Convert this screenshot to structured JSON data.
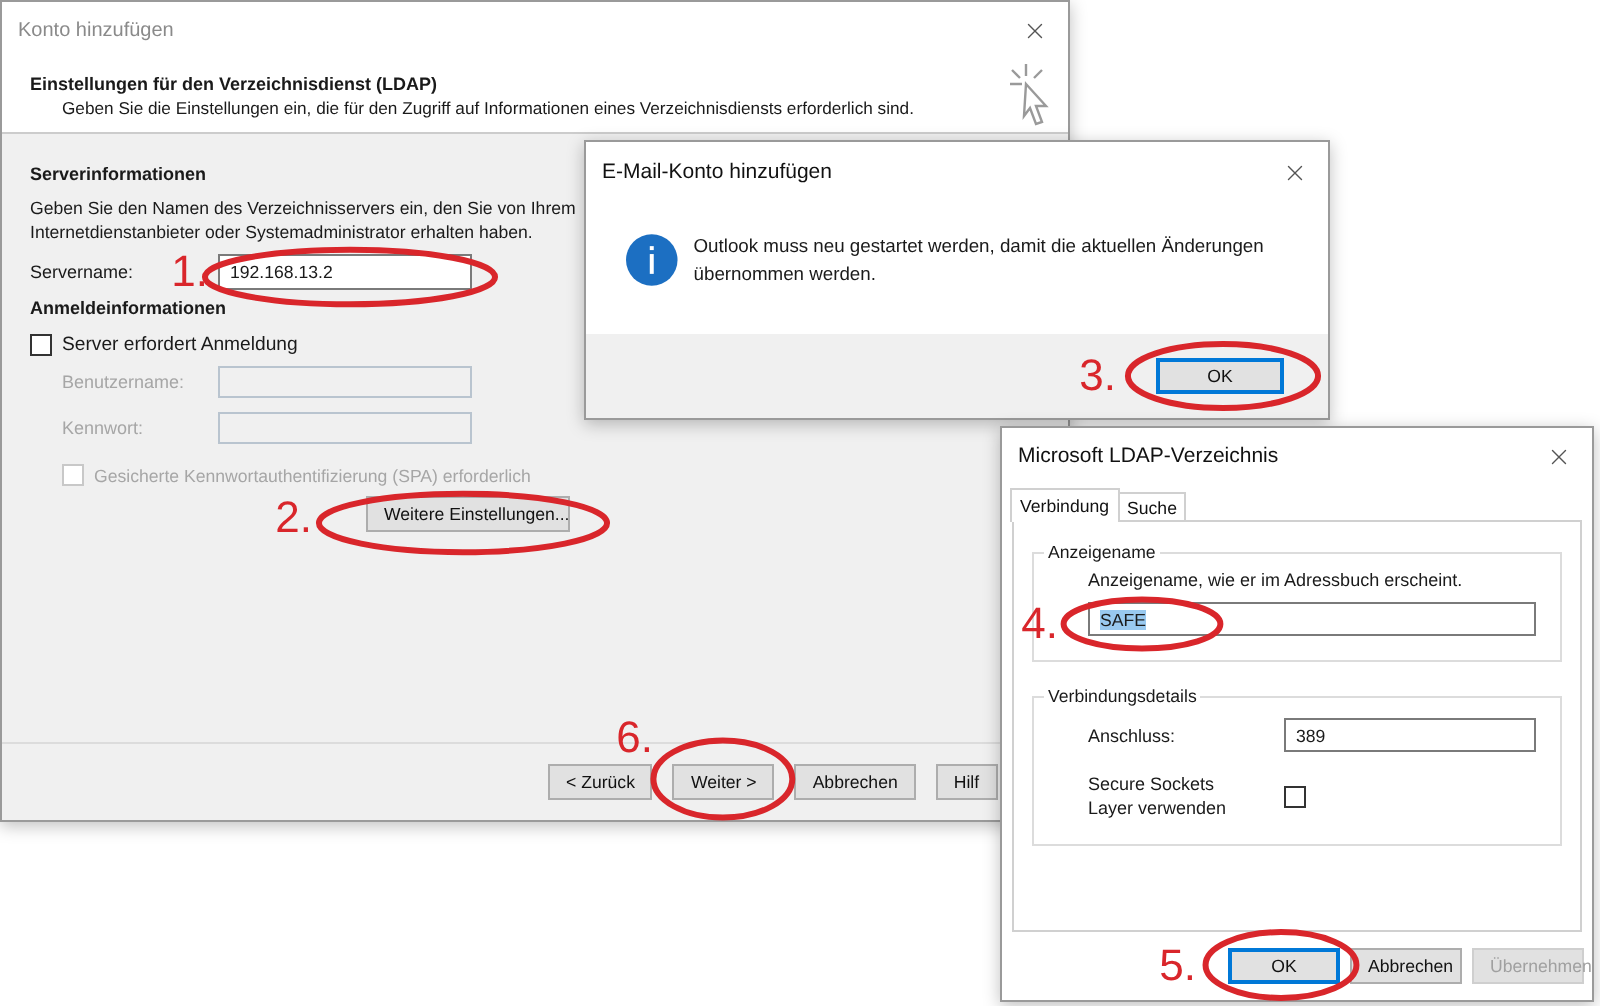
{
  "main_window": {
    "title": "Konto hinzufügen",
    "header_title": "Einstellungen für den Verzeichnisdienst (LDAP)",
    "header_subtitle": "Geben Sie die Einstellungen ein, die für den Zugriff auf Informationen eines Verzeichnisdiensts erforderlich sind.",
    "server_section": "Serverinformationen",
    "server_description": [
      "Geben Sie den Namen des Verzeichnisservers ein, den Sie von Ihrem",
      "Internetdienstanbieter oder Systemadministrator erhalten haben."
    ],
    "server_name": {
      "label": "Servername:",
      "value": "192.168.13.2",
      "step": "1."
    },
    "login_section": "Anmeldeinformationen",
    "requires_login": {
      "label": "Server erfordert Anmeldung",
      "checked": false
    },
    "username": {
      "label": "Benutzername:",
      "disabled": true
    },
    "password": {
      "label": "Kennwort:",
      "disabled": true
    },
    "spa": {
      "label": "Gesicherte Kennwortauthentifizierung (SPA) erforderlich",
      "checked": false,
      "disabled": true
    },
    "more_settings": {
      "label": "Weitere Einstellungen...",
      "step": "2."
    },
    "buttons": [
      {
        "label": "< Zurück"
      },
      {
        "label": "Weiter >",
        "step": "6."
      },
      {
        "label": "Abbrechen"
      },
      {
        "label": "Hilf"
      }
    ]
  },
  "email_dialog": {
    "title": "E-Mail-Konto hinzufügen",
    "message": "Outlook muss neu gestartet werden, damit die aktuellen Änderungen übernommen werden.",
    "button": {
      "label": "OK",
      "default": true,
      "step": "3."
    }
  },
  "ldap_dialog": {
    "title": "Microsoft LDAP-Verzeichnis",
    "tabs": [
      {
        "label": "Verbindung",
        "selected": true
      },
      {
        "label": "Suche",
        "selected": false
      }
    ],
    "display_group": {
      "title": "Anzeigename",
      "description": "Anzeigename, wie er im Adressbuch erscheint.",
      "value": "SAFE",
      "value_selected": true,
      "step": "4."
    },
    "connection_group": {
      "title": "Verbindungsdetails",
      "port_label": "Anschluss:",
      "port_value": "389",
      "ssl_label": "Secure Sockets Layer verwenden",
      "ssl_checked": false
    },
    "buttons": [
      {
        "label": "OK",
        "default": true,
        "disabled": false,
        "step": "5."
      },
      {
        "label": "Abbrechen",
        "default": false,
        "disabled": false
      },
      {
        "label": "Übernehmen",
        "default": false,
        "disabled": true
      }
    ]
  }
}
